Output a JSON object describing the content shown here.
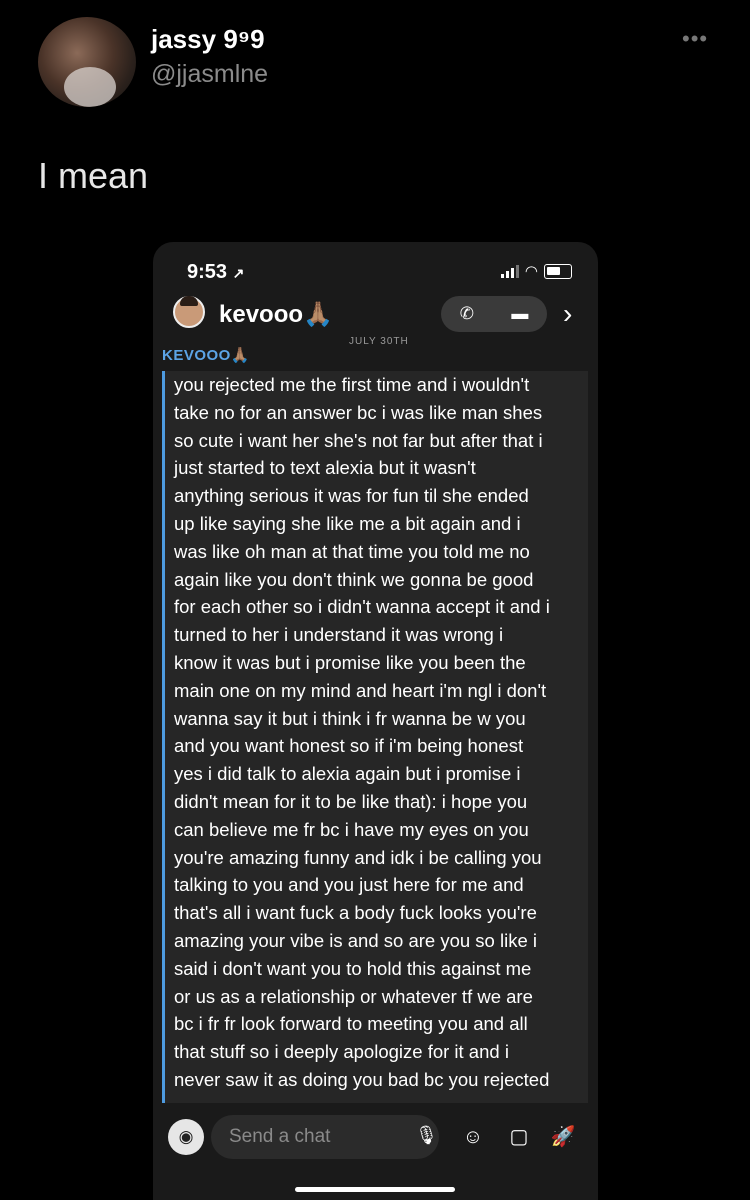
{
  "tweet": {
    "author_name": "jassy",
    "author_name_suffix": "9⁹9",
    "handle": "@jjasmlne",
    "more_icon": "more-dots-icon",
    "text": "I mean"
  },
  "screenshot": {
    "status_time": "9:53",
    "location_arrow": "↗",
    "contact_name": "kevooo🙏🏽",
    "call_icon": "phone-icon",
    "video_icon": "video-camera-icon",
    "chevron_icon": "chevron-right-icon",
    "date_label": "JULY 30TH",
    "sender_label": "KEVOOO🙏🏽",
    "message_lines": [
      "you rejected me the first time and i wouldn't",
      "take no for an answer bc i was like man shes",
      "so cute i want her she's not far but after that i",
      "just started to text alexia but it wasn't",
      "anything serious it was for fun til she ended",
      "up like saying she like me a bit again and i",
      "was like oh man at that time you told me no",
      "again like you don't think we gonna be good",
      "for each other so i didn't wanna accept it and i",
      "turned to her i understand it was wrong i",
      "know it was but i promise like you been the",
      "main one on my mind and heart i'm ngl i don't",
      "wanna say it but i think i fr wanna be w you",
      "and you want honest so if i'm being honest",
      "yes i did talk to alexia again but i promise i",
      "didn't mean for it to be like that): i hope you",
      "can believe me fr bc i have my eyes on you",
      "you're amazing funny and idk i be calling you",
      "talking to you and you just here for me and",
      "that's all i want fuck a body fuck looks you're",
      "amazing your vibe is and so are you so like i",
      "said i don't want you to hold this against me",
      "or us as a relationship or whatever tf we are",
      "bc i fr fr look forward to meeting you and all",
      "that stuff so i deeply apologize for it and i",
      "never saw it as doing you bad bc you rejected"
    ],
    "chat_placeholder": "Send a chat",
    "accent_color": "#4e9be0"
  }
}
